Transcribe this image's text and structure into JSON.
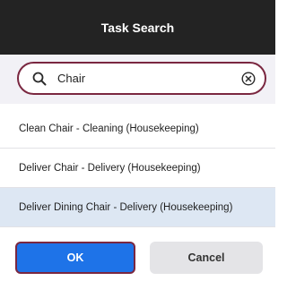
{
  "dialog": {
    "title": "Task Search"
  },
  "search": {
    "value": "Chair",
    "icons": {
      "search": "search-icon",
      "clear": "clear-icon"
    }
  },
  "results": [
    {
      "label": "Clean Chair - Cleaning (Housekeeping)",
      "selected": false
    },
    {
      "label": "Deliver Chair - Delivery (Housekeeping)",
      "selected": false
    },
    {
      "label": "Deliver Dining Chair - Delivery (Housekeeping)",
      "selected": true
    }
  ],
  "buttons": {
    "ok_label": "OK",
    "cancel_label": "Cancel"
  },
  "colors": {
    "header_bg": "#232323",
    "focus_outline": "#7a2740",
    "primary": "#1e73e8",
    "selected_row": "#dde7f3"
  }
}
